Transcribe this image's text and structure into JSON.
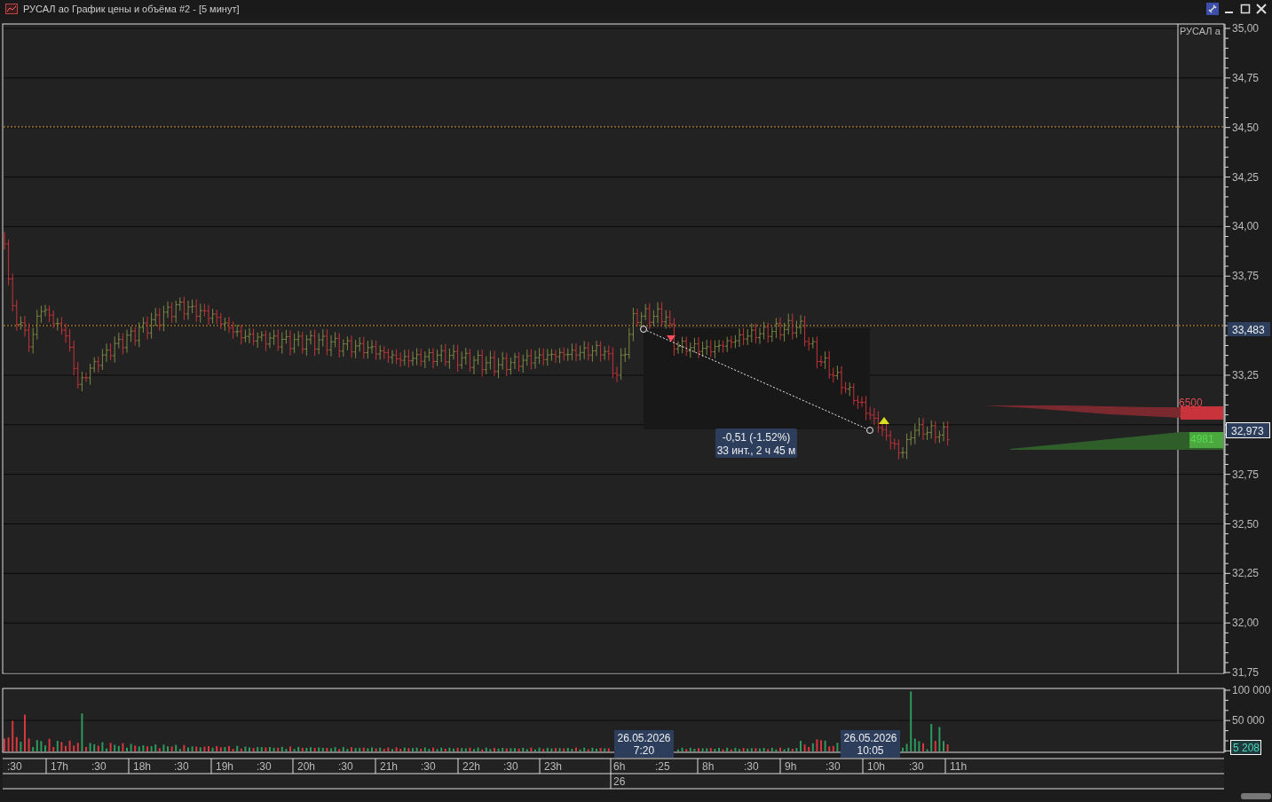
{
  "window": {
    "title": "РУСАЛ ао График цены и объёма #2 - [5 минут]"
  },
  "price_panel": {
    "instrument_label": "РУСАЛ а",
    "y_ticks": [
      "35,00",
      "34,75",
      "34,50",
      "34,25",
      "34,00",
      "33,75",
      "33,25",
      "32,75",
      "32,50",
      "32,25",
      "32,00",
      "31,75"
    ],
    "crosshair_price": "33,483",
    "last_price": "32,973",
    "measure": {
      "change": "-0,51 (-1.52%)",
      "span": "33 инт., 2 ч 45 м"
    },
    "order_book": {
      "ask_volume": "6500",
      "bid_volume": "4981"
    }
  },
  "volume_panel": {
    "y_ticks": [
      "100 000",
      "50 000"
    ],
    "last_volume": "5 208"
  },
  "time_axis": {
    "labels": [
      ":30",
      "17h",
      ":30",
      "18h",
      ":30",
      "19h",
      ":30",
      "20h",
      ":30",
      "21h",
      ":30",
      "22h",
      ":30",
      "23h",
      "6h",
      ":25",
      "8h",
      ":30",
      "9h",
      ":30",
      "10h",
      ":30",
      "11h"
    ],
    "date_labels": [
      "26"
    ],
    "cursor_labels": [
      {
        "date": "26.05.2026",
        "time": "7:20"
      },
      {
        "date": "26.05.2026",
        "time": "10:05"
      }
    ]
  }
}
